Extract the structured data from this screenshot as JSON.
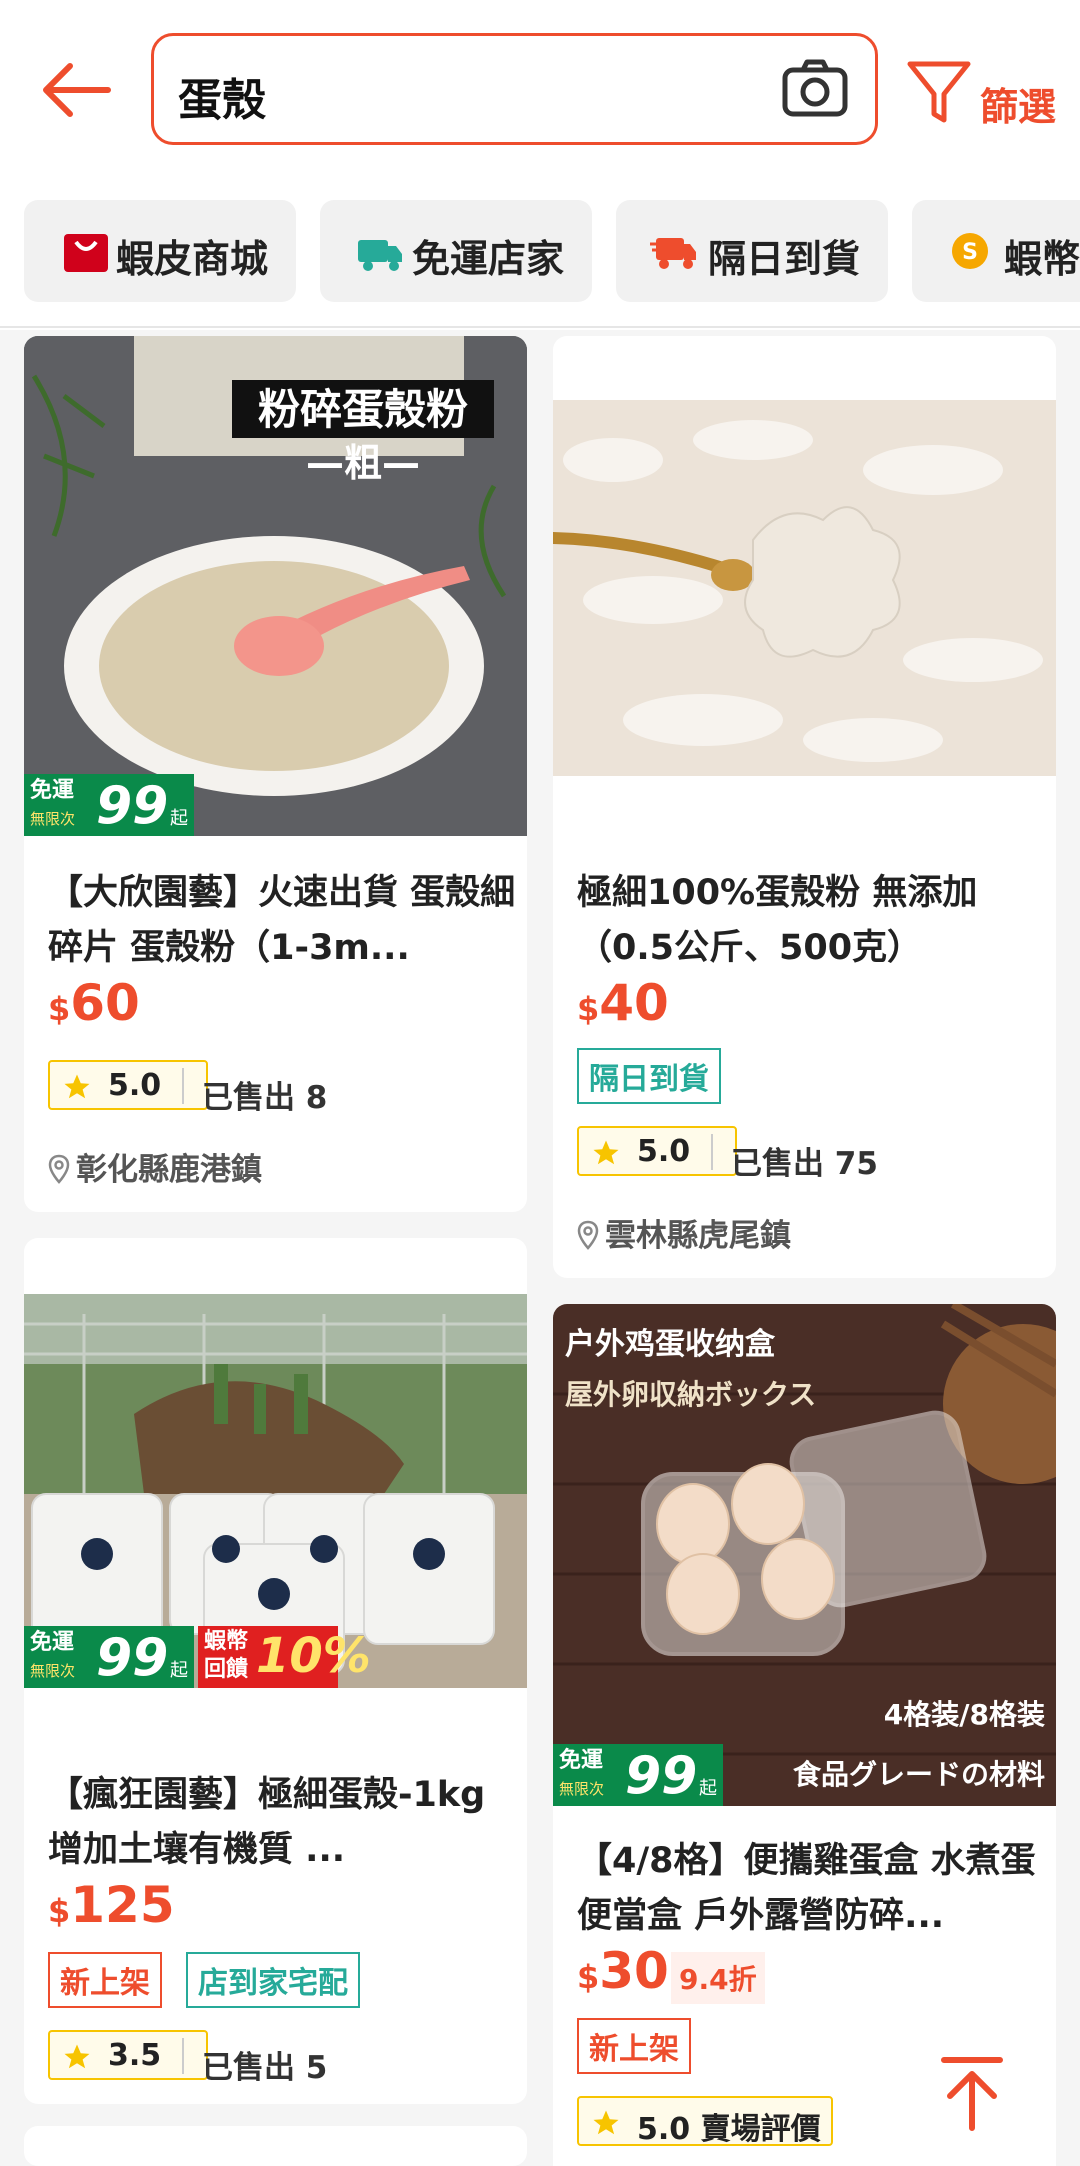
{
  "search": {
    "query": "蛋殼"
  },
  "header": {
    "filter_label": "篩選"
  },
  "chips": [
    {
      "label": "蝦皮商城",
      "icon": "shopee-mall-bag-icon"
    },
    {
      "label": "免運店家",
      "icon": "free-shipping-truck-icon"
    },
    {
      "label": "隔日到貨",
      "icon": "next-day-delivery-truck-icon"
    },
    {
      "label": "蝦幣",
      "icon": "shopee-coin-icon"
    }
  ],
  "image_tags": {
    "free_shipping": {
      "main": "免運",
      "sub": "無限次",
      "currency": "$",
      "amount": "99",
      "suffix": "起"
    },
    "coin_cashback": {
      "main": "蝦幣",
      "sub": "回饋",
      "amount": "10%"
    }
  },
  "products": [
    {
      "image_text": [
        "粉碎蛋殼粉",
        "—粗—"
      ],
      "title": "【大欣園藝】火速出貨 蛋殼細碎片 蛋殼粉（1-3m...",
      "currency": "$",
      "price": "60",
      "rating": "5.0",
      "sold": "已售出 8",
      "location": "彰化縣鹿港鎮"
    },
    {
      "title": "極細100%蛋殼粉 無添加（0.5公斤、500克）",
      "currency": "$",
      "price": "40",
      "labels": [
        "隔日到貨"
      ],
      "rating": "5.0",
      "sold": "已售出 75",
      "location": "雲林縣虎尾鎮"
    },
    {
      "title": "【瘋狂園藝】極細蛋殼-1kg 增加土壤有機質 ...",
      "currency": "$",
      "price": "125",
      "labels": [
        "新上架",
        "店到家宅配"
      ],
      "rating": "3.5",
      "sold": "已售出 5"
    },
    {
      "image_text": [
        "户外鸡蛋收纳盒",
        "屋外卵収納ボックス",
        "4格装/8格装",
        "食品グレードの材料"
      ],
      "title": "【4/8格】便攜雞蛋盒 水煮蛋便當盒 戶外露營防碎...",
      "currency": "$",
      "price": "30",
      "discount": "9.4折",
      "labels": [
        "新上架"
      ],
      "rating": "5.0 賣場評價"
    }
  ],
  "colors": {
    "brand": "#ee4d2d",
    "teal": "#26aa99",
    "star": "#f7c400"
  }
}
